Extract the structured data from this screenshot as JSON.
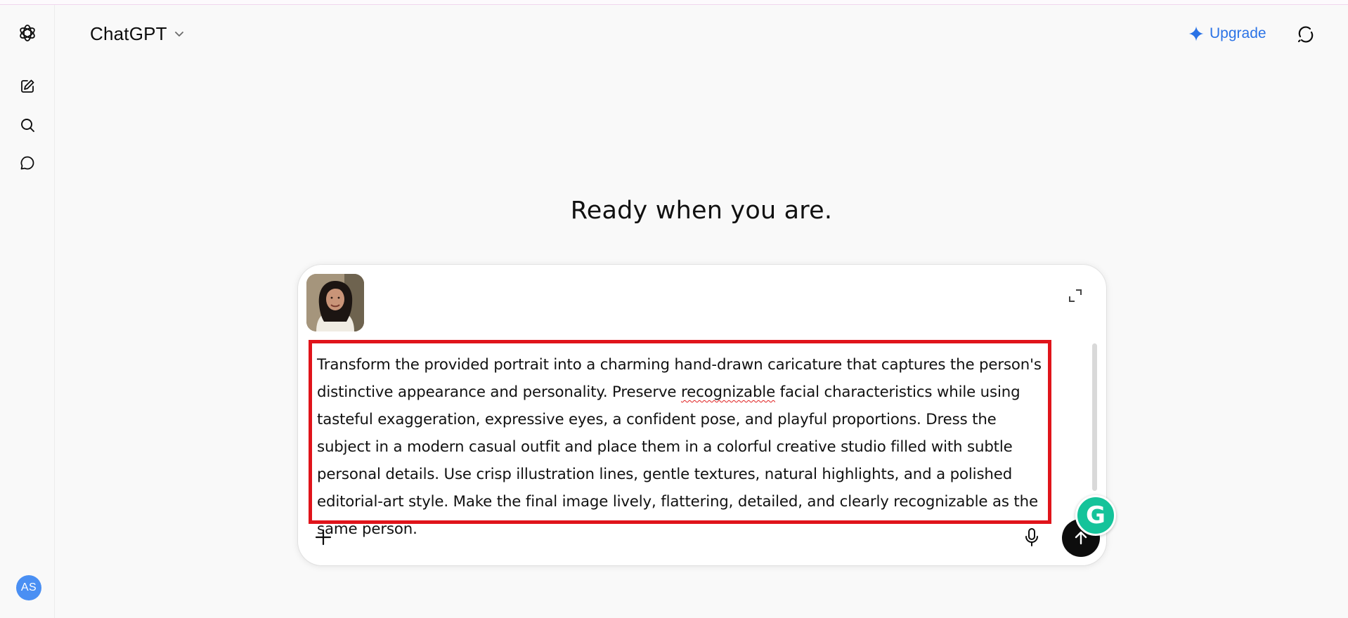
{
  "header": {
    "model_name": "ChatGPT",
    "upgrade_label": "Upgrade"
  },
  "sidebar": {
    "items": [
      {
        "icon": "openai-logo-icon"
      },
      {
        "icon": "new-chat-icon"
      },
      {
        "icon": "search-icon"
      },
      {
        "icon": "chats-icon"
      }
    ],
    "avatar_initials": "AS"
  },
  "main": {
    "headline": "Ready when you are."
  },
  "composer": {
    "attachment": "portrait-image",
    "prompt_before": "Transform the provided portrait into a charming hand-drawn caricature that captures the person's distinctive appearance and personality. Preserve ",
    "prompt_misspelled": "recognizable",
    "prompt_after": " facial characteristics while using tasteful exaggeration, expressive eyes, a confident pose, and playful proportions. Dress the subject in a modern casual outfit and place them in a colorful creative studio filled with subtle personal details. Use crisp illustration lines, gentle textures, natural highlights, and a polished editorial-art style. Make the final image lively, flattering, detailed, and clearly recognizable as the same person."
  },
  "colors": {
    "accent": "#2b73e6",
    "highlight_border": "#e0141b",
    "send_button": "#0d0d0d",
    "grammarly": "#15c39a",
    "avatar": "#4a8ff3"
  }
}
